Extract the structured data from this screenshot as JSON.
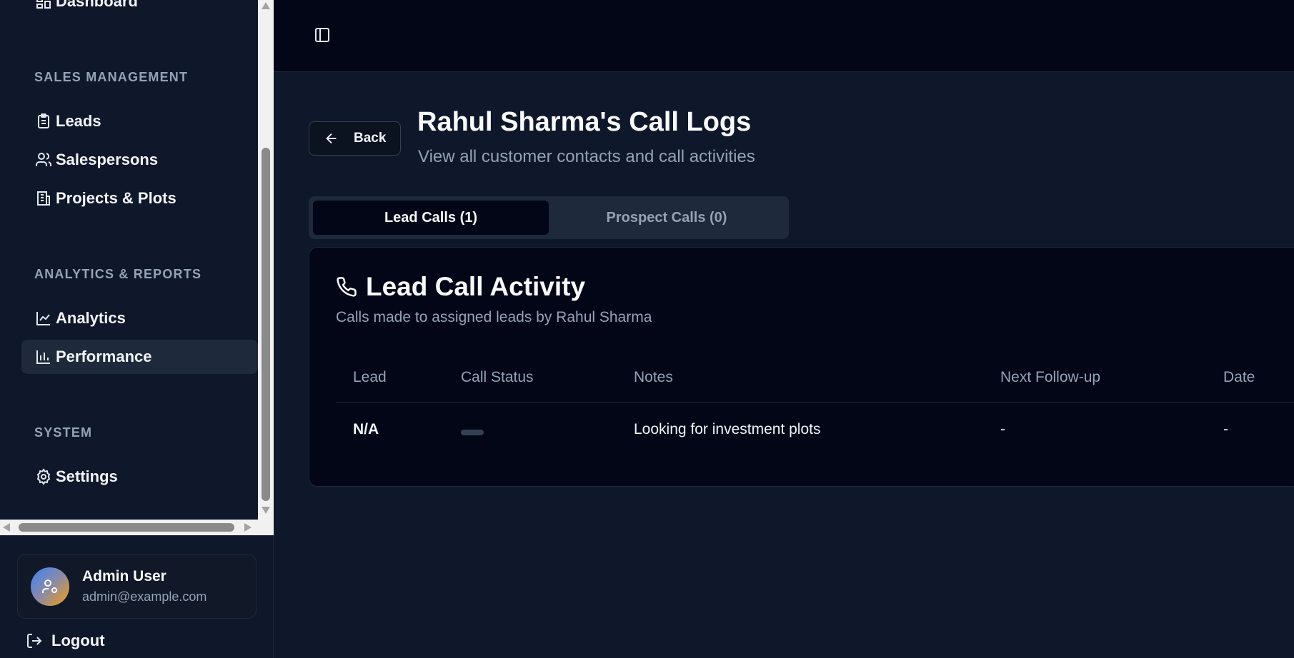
{
  "sidebar": {
    "top_item": "Dashboard",
    "sections": [
      {
        "title": "SALES MANAGEMENT",
        "items": [
          "Leads",
          "Salespersons",
          "Projects & Plots"
        ]
      },
      {
        "title": "ANALYTICS & REPORTS",
        "items": [
          "Analytics",
          "Performance"
        ]
      },
      {
        "title": "SYSTEM",
        "items": [
          "Settings"
        ]
      }
    ],
    "active_item": "Performance"
  },
  "user": {
    "name": "Admin User",
    "email": "admin@example.com",
    "logout_label": "Logout"
  },
  "page": {
    "back_label": "Back",
    "title": "Rahul Sharma's Call Logs",
    "subtitle": "View all customer contacts and call activities"
  },
  "tabs": [
    {
      "label": "Lead Calls (1)",
      "active": true
    },
    {
      "label": "Prospect Calls (0)",
      "active": false
    }
  ],
  "card": {
    "title": "Lead Call Activity",
    "description": "Calls made to assigned leads by Rahul Sharma",
    "columns": [
      "Lead",
      "Call Status",
      "Notes",
      "Next Follow-up",
      "Date"
    ],
    "rows": [
      {
        "lead": "N/A",
        "call_status": "",
        "notes": "Looking for investment plots",
        "next_follow_up": "-",
        "date": "-"
      }
    ]
  },
  "colors": {
    "background": "#0f172a",
    "surface": "#020617",
    "muted_text": "#94a3b8",
    "active_bg": "#1e293b"
  }
}
